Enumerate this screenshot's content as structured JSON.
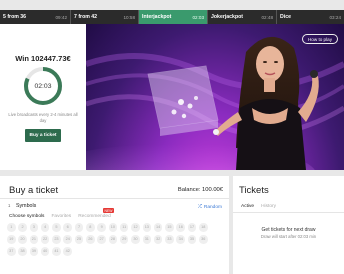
{
  "games": [
    {
      "name": "5 from 36",
      "time": "09:42",
      "active": false
    },
    {
      "name": "7 from 42",
      "time": "10:58",
      "active": false
    },
    {
      "name": "Interjackpot",
      "time": "02:03",
      "active": true
    },
    {
      "name": "Jokerjackpot",
      "time": "02:48",
      "active": false
    },
    {
      "name": "Dice",
      "time": "03:24",
      "active": false
    }
  ],
  "win": {
    "title": "Win 102447.73€",
    "countdown": "02:03",
    "progress": 0.82,
    "info": "Live broadcasts every 2-4 minutes all day",
    "buy_label": "Buy a ticket"
  },
  "video": {
    "how_to_play": "How to play"
  },
  "buy": {
    "title": "Buy a ticket",
    "balance": "Balance: 100.00€",
    "step": "1",
    "section_title": "Symbols",
    "random_label": "Random",
    "tabs": [
      "Choose symbols",
      "Favorites",
      "Recommended"
    ],
    "new_badge": "NEW",
    "numbers": [
      "1",
      "2",
      "3",
      "4",
      "5",
      "6",
      "7",
      "8",
      "9",
      "10",
      "11",
      "12",
      "13",
      "14",
      "15",
      "16",
      "17",
      "18",
      "19",
      "20",
      "21",
      "22",
      "23",
      "24",
      "25",
      "26",
      "27",
      "28",
      "29",
      "30",
      "31",
      "32",
      "33",
      "34",
      "35",
      "36",
      "37",
      "38",
      "39",
      "40",
      "41",
      "42"
    ]
  },
  "tickets": {
    "title": "Tickets",
    "tabs": [
      "Active",
      "History"
    ],
    "empty_title": "Get tickets for next draw",
    "empty_note": "Draw will start after 02:03 min"
  },
  "colors": {
    "accent": "#2d6b4d",
    "active_tab": "#3a9a6d",
    "ring": "#3b7a58",
    "link": "#3e7bd6"
  }
}
